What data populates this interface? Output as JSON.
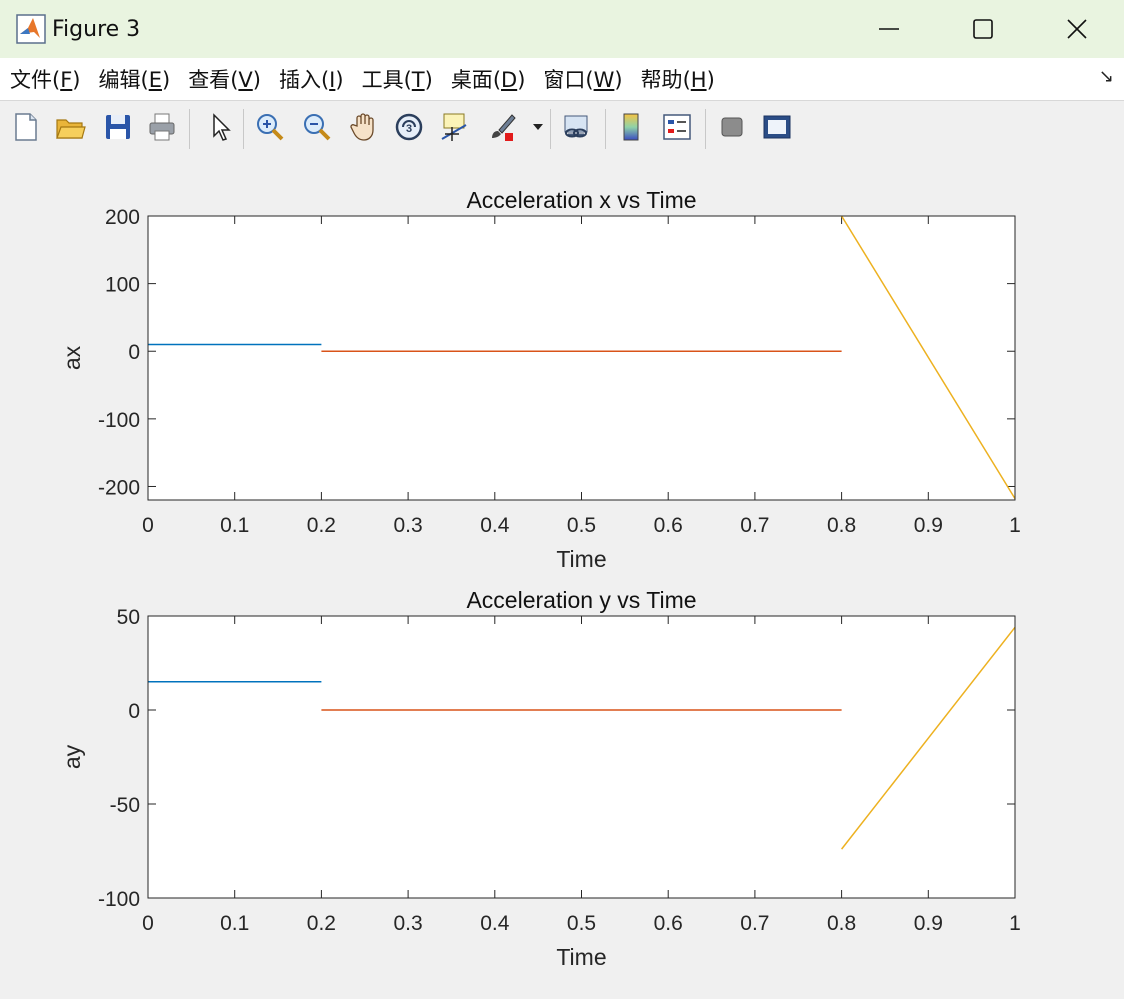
{
  "window": {
    "title": "Figure 3"
  },
  "menu": {
    "items": [
      {
        "label": "文件",
        "key": "F"
      },
      {
        "label": "编辑",
        "key": "E"
      },
      {
        "label": "查看",
        "key": "V"
      },
      {
        "label": "插入",
        "key": "I"
      },
      {
        "label": "工具",
        "key": "T"
      },
      {
        "label": "桌面",
        "key": "D"
      },
      {
        "label": "窗口",
        "key": "W"
      },
      {
        "label": "帮助",
        "key": "H"
      }
    ]
  },
  "toolbar": {
    "icons": [
      "new-file-icon",
      "open-folder-icon",
      "save-icon",
      "print-icon",
      "pointer-icon",
      "zoom-in-icon",
      "zoom-out-icon",
      "pan-hand-icon",
      "rotate-3d-icon",
      "data-cursor-icon",
      "brush-icon",
      "link-plot-icon",
      "colorbar-icon",
      "legend-icon",
      "hide-plot-tools-icon",
      "show-plot-tools-icon"
    ]
  },
  "colors": {
    "series1": "#0072BD",
    "series2": "#D95319",
    "series3": "#EDB120"
  },
  "chart_data": [
    {
      "type": "line",
      "title": "Acceleration x vs Time",
      "xlabel": "Time",
      "ylabel": "ax",
      "xlim": [
        0,
        1
      ],
      "ylim": [
        -220,
        200
      ],
      "xticks": [
        "0",
        "0.1",
        "0.2",
        "0.3",
        "0.4",
        "0.5",
        "0.6",
        "0.7",
        "0.8",
        "0.9",
        "1"
      ],
      "yticks": [
        "-200",
        "-100",
        "0",
        "100",
        "200"
      ],
      "ytick_values": [
        -200,
        -100,
        0,
        100,
        200
      ],
      "series": [
        {
          "x": [
            0,
            0.2
          ],
          "y": [
            10,
            10
          ],
          "color": "#0072BD"
        },
        {
          "x": [
            0.2,
            0.8
          ],
          "y": [
            0,
            0
          ],
          "color": "#D95319"
        },
        {
          "x": [
            0.8,
            1.0
          ],
          "y": [
            200,
            -218
          ],
          "color": "#EDB120"
        }
      ]
    },
    {
      "type": "line",
      "title": "Acceleration y vs Time",
      "xlabel": "Time",
      "ylabel": "ay",
      "xlim": [
        0,
        1
      ],
      "ylim": [
        -100,
        50
      ],
      "xticks": [
        "0",
        "0.1",
        "0.2",
        "0.3",
        "0.4",
        "0.5",
        "0.6",
        "0.7",
        "0.8",
        "0.9",
        "1"
      ],
      "yticks": [
        "-100",
        "-50",
        "0",
        "50"
      ],
      "ytick_values": [
        -100,
        -50,
        0,
        50
      ],
      "series": [
        {
          "x": [
            0,
            0.2
          ],
          "y": [
            15,
            15
          ],
          "color": "#0072BD"
        },
        {
          "x": [
            0.2,
            0.8
          ],
          "y": [
            0,
            0
          ],
          "color": "#D95319"
        },
        {
          "x": [
            0.8,
            1.0
          ],
          "y": [
            -74,
            44
          ],
          "color": "#EDB120"
        }
      ]
    }
  ]
}
